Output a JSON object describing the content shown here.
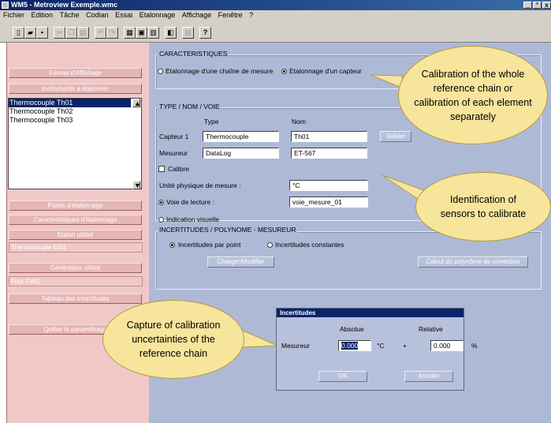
{
  "window": {
    "title": "WM5 - Metroview Exemple.wmc",
    "controls": [
      "_",
      "°",
      "x"
    ]
  },
  "menu": [
    "Fichier",
    "Edition",
    "Tâche",
    "Codian",
    "Essai",
    "Etalonnage",
    "Affichage",
    "Fenêtre",
    "?"
  ],
  "toolbar": {
    "icons": [
      "new-icon",
      "open-icon",
      "save-icon",
      "cut-icon",
      "copy-icon",
      "paste-icon",
      "undo-icon",
      "redo-icon",
      "print-icon",
      "preview-icon",
      "calc-icon",
      "window-icon",
      "settings-icon",
      "help-icon"
    ]
  },
  "left_panel": {
    "format_button": "Format d'Affichage",
    "instruments_button": "Instruments à étalonner",
    "instruments": [
      "Thermocouple Th01",
      "Thermocouple Th02",
      "Thermocouple Th03"
    ],
    "selected_index": 0,
    "points_button": "Points d'étalonnage",
    "characteristics_button": "Caractéristiques d'étalonnage",
    "standard_button": "Etalon utilisé",
    "standard_value": "Thermocouple Et01",
    "generator_button": "Générateur utilisé",
    "generator_value": "Four Fo01",
    "uncertainties_button": "Tableau des incertitudes",
    "quit_button": "Quitter le paramétrage"
  },
  "characteristics": {
    "title": "CARACTERISTIQUES",
    "option_chain": "Etalonnage d'une chaîne de mesure",
    "option_sensor": "Etalonnage d'un capteur",
    "selected": "sensor"
  },
  "type_section": {
    "title": "TYPE / NOM / VOIE",
    "col_type": "Type",
    "col_nom": "Nom",
    "capteur_label": "Capteur 1",
    "capteur_type": "Thermocouple",
    "capteur_nom": "Th01",
    "validate_button": "Valider",
    "mesureur_label": "Mesureur",
    "mesureur_type": "DataLog",
    "mesureur_nom": "ET-567",
    "calibre_label": "Calibre",
    "unit_label": "Unité physique de mesure :",
    "unit_value": "°C",
    "voie_label": "Voie de lecture :",
    "voie_value": "voie_mesure_01",
    "visual_label": "Indication visuelle"
  },
  "uncertainties_section": {
    "title": "INCERTITUDES / POLYNOME - MESUREUR",
    "option_point": "Incertitudes par point",
    "option_const": "Incertitudes constantes",
    "load_button": "Charger/Modifier",
    "poly_button": "Calcul du polynôme de correction"
  },
  "dialog": {
    "title": "Incertitudes",
    "col_abs": "Absolue",
    "col_rel": "Relative",
    "row_label": "Mesureur",
    "abs_value": "0.000",
    "abs_unit": "°C",
    "plus": "+",
    "rel_value": "0.000",
    "rel_unit": "%",
    "ok_button": "OK",
    "cancel_button": "Annuler"
  },
  "callouts": {
    "calibration": "Calibration of the whole reference chain or calibration of each element separately",
    "identification": "Identification of sensors to calibrate",
    "capture": "Capture of calibration uncertainties of the reference chain"
  }
}
